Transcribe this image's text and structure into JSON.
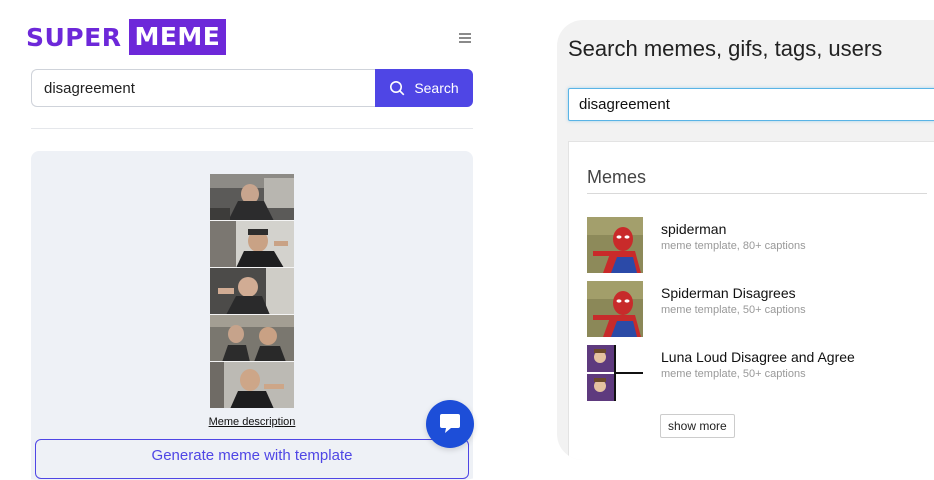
{
  "left": {
    "logo": {
      "part1": "SUPER",
      "part2": "MEME"
    },
    "search": {
      "value": "disagreement",
      "button_label": "Search"
    },
    "result": {
      "description_link": "Meme description",
      "generate_label": "Generate meme with template"
    },
    "colors": {
      "brand": "#6d28d9",
      "accent": "#4f46e5",
      "chat": "#1d4ed8"
    }
  },
  "right": {
    "title": "Search memes, gifs, tags, users",
    "search_value": "disagreement",
    "section_label": "Memes",
    "items": [
      {
        "name": "spiderman",
        "sub": "meme template, 80+ captions"
      },
      {
        "name": "Spiderman Disagrees",
        "sub": "meme template, 50+ captions"
      },
      {
        "name": "Luna Loud Disagree and Agree",
        "sub": "meme template, 50+ captions"
      }
    ],
    "show_more": "show more"
  }
}
